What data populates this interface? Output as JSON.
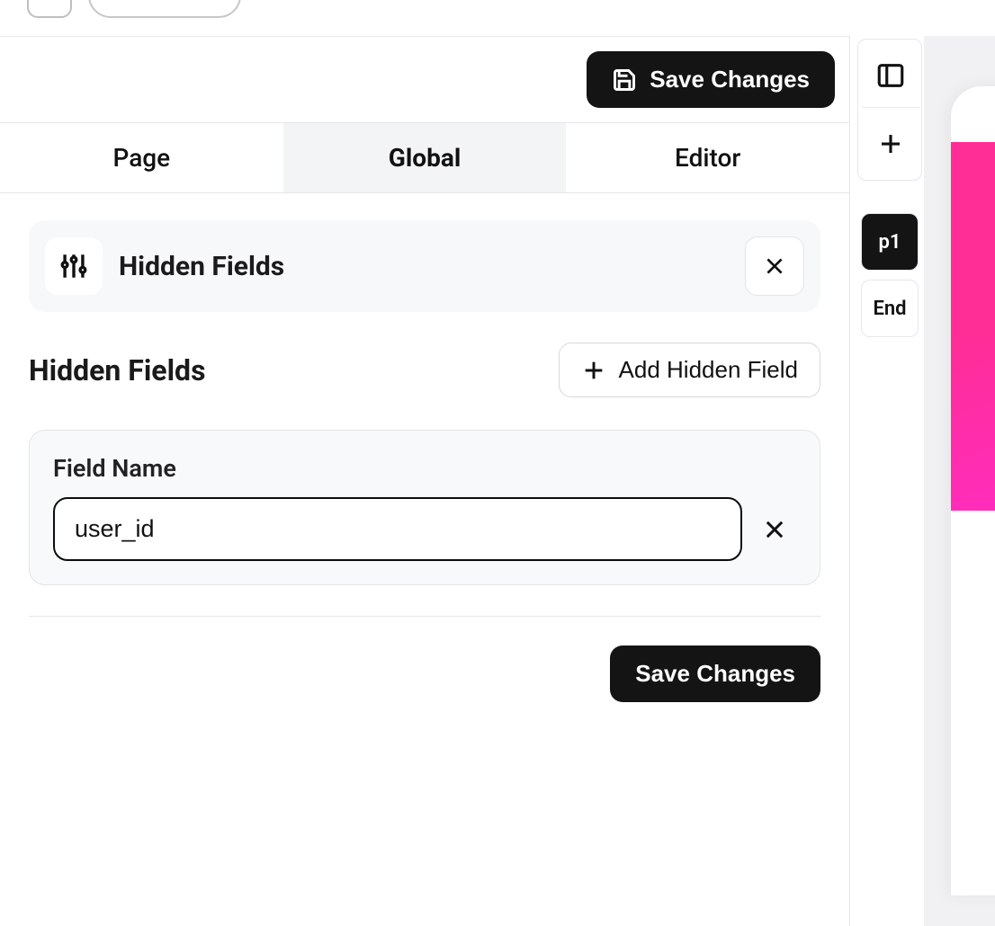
{
  "header": {
    "save_label": "Save Changes"
  },
  "tabs": {
    "page": "Page",
    "global": "Global",
    "editor": "Editor",
    "active": "global"
  },
  "section": {
    "title": "Hidden Fields"
  },
  "subheader": {
    "title": "Hidden Fields",
    "add_label": "Add Hidden Field"
  },
  "field": {
    "label": "Field Name",
    "value": "user_id"
  },
  "footer": {
    "save_label": "Save Changes"
  },
  "rail": {
    "p1": "p1",
    "end": "End"
  }
}
